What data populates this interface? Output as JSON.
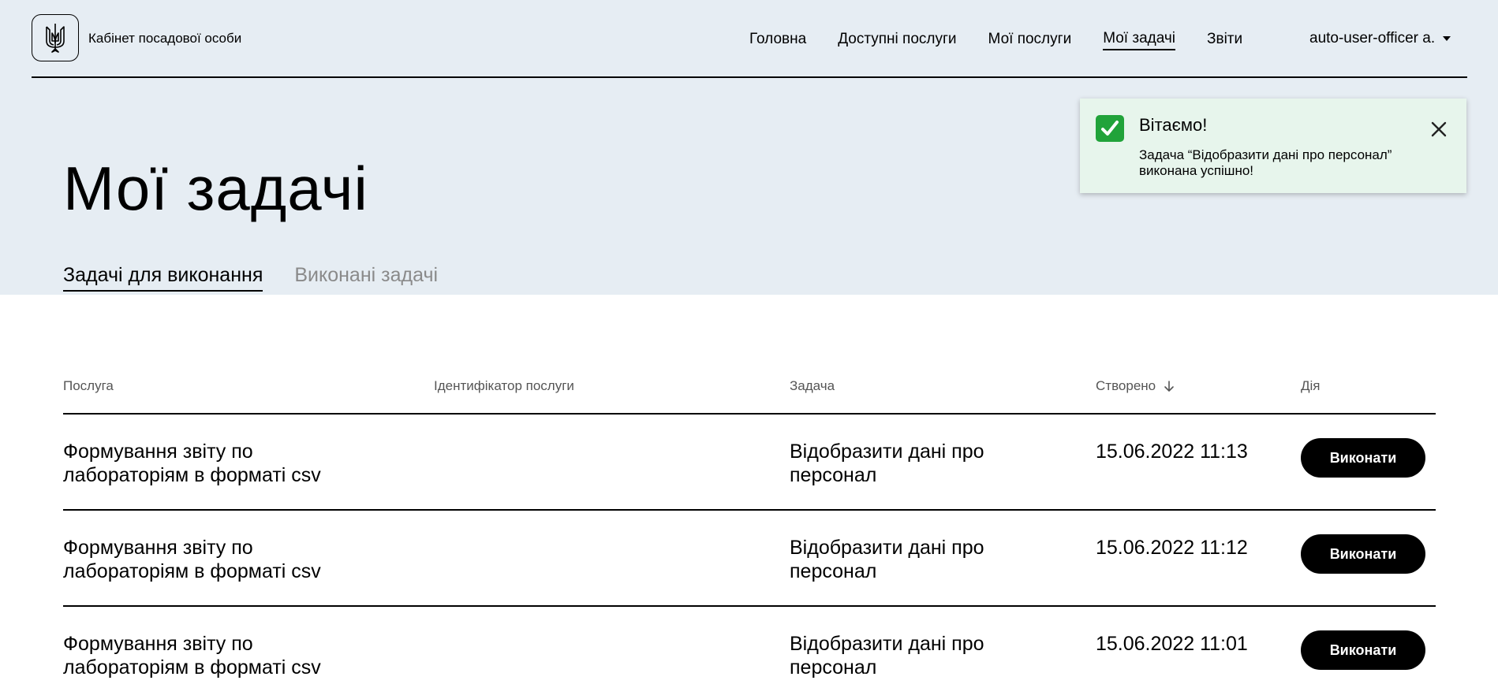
{
  "header": {
    "brand": "Кабінет посадової особи",
    "logo_icon": "trident-icon",
    "nav": [
      {
        "label": "Головна",
        "active": false
      },
      {
        "label": "Доступні послуги",
        "active": false
      },
      {
        "label": "Мої послуги",
        "active": false
      },
      {
        "label": "Мої задачі",
        "active": true
      },
      {
        "label": "Звіти",
        "active": false
      }
    ],
    "user": "auto-user-officer a."
  },
  "page": {
    "title": "Мої задачі",
    "tabs": [
      {
        "label": "Задачі для виконання",
        "active": true
      },
      {
        "label": "Виконані задачі",
        "active": false
      }
    ]
  },
  "toast": {
    "icon": "check-icon",
    "title": "Вітаємо!",
    "message": "Задача “Відобразити дані про персонал” виконана успішно!",
    "color": "#e7f5ec",
    "accent": "#21a33a"
  },
  "table": {
    "columns": {
      "service": "Послуга",
      "service_id": "Ідентифікатор послуги",
      "task": "Задача",
      "created": "Створено",
      "action": "Дія"
    },
    "sort": {
      "column": "created",
      "direction": "desc"
    },
    "rows": [
      {
        "service": "Формування звіту по лабораторіям в форматі csv",
        "service_id": "",
        "task": "Відобразити дані про персонал",
        "created": "15.06.2022 11:13",
        "action": "Виконати"
      },
      {
        "service": "Формування звіту по лабораторіям в форматі csv",
        "service_id": "",
        "task": "Відобразити дані про персонал",
        "created": "15.06.2022 11:12",
        "action": "Виконати"
      },
      {
        "service": "Формування звіту по лабораторіям в форматі csv",
        "service_id": "",
        "task": "Відобразити дані про персонал",
        "created": "15.06.2022 11:01",
        "action": "Виконати"
      }
    ]
  },
  "colors": {
    "header_background": "#e6edf3",
    "button": "#000000",
    "inactive_tab": "#8a8a8a"
  }
}
